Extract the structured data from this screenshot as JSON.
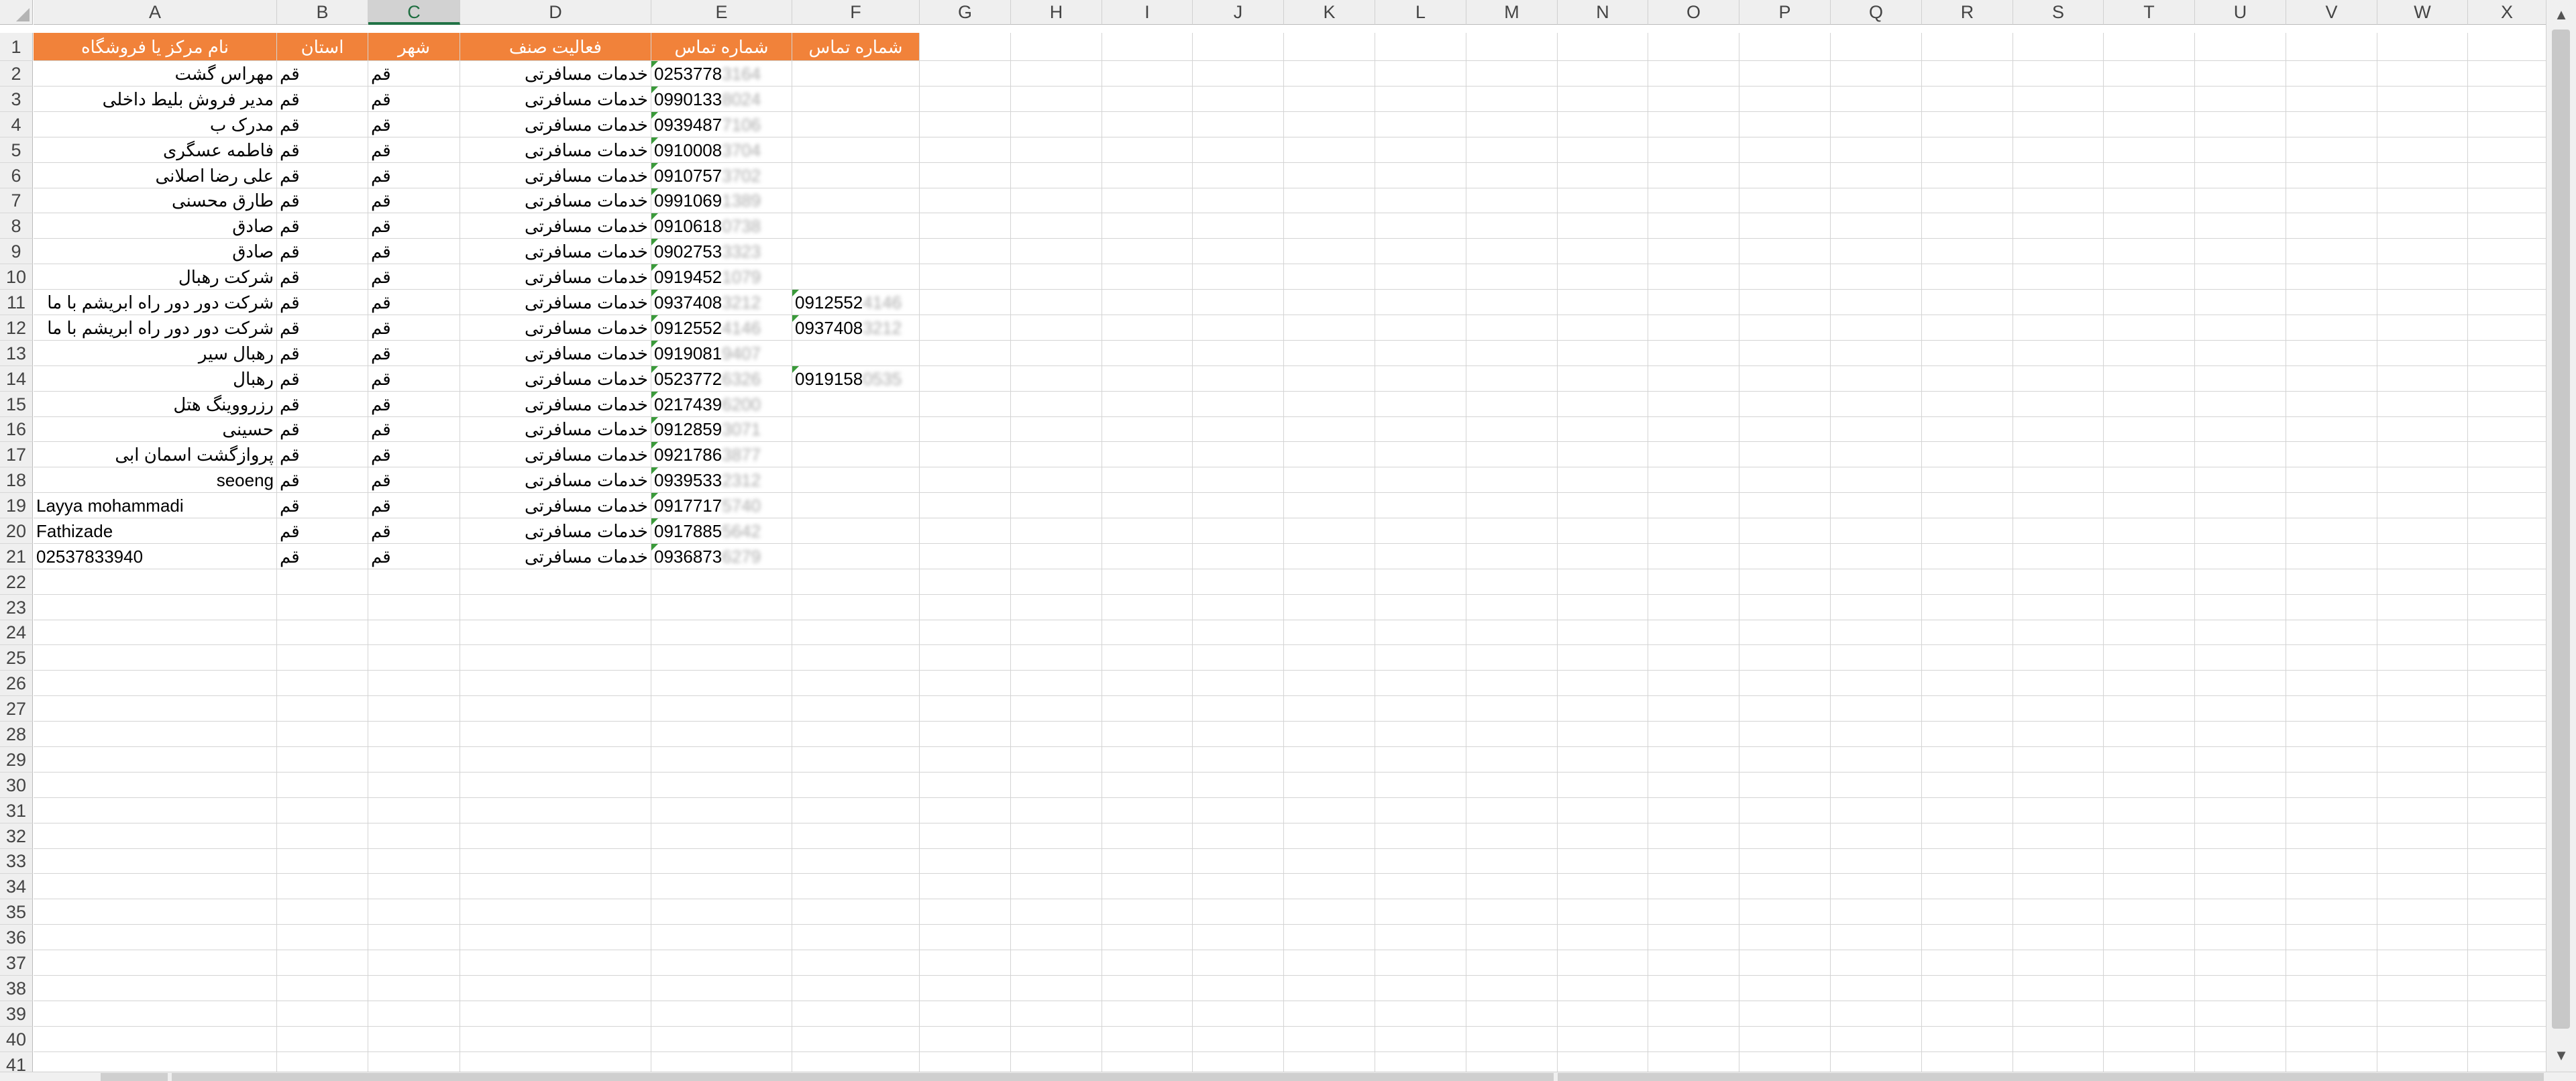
{
  "sheet": {
    "columns": [
      "A",
      "B",
      "C",
      "D",
      "E",
      "F",
      "G",
      "H",
      "I",
      "J",
      "K",
      "L",
      "M",
      "N",
      "O",
      "P",
      "Q",
      "R",
      "S",
      "T",
      "U",
      "V",
      "W",
      "X"
    ],
    "selected_column": "C",
    "row_numbers": [
      "1",
      "2",
      "3",
      "4",
      "5",
      "6",
      "7",
      "8",
      "9",
      "10",
      "11",
      "12",
      "13",
      "14",
      "15",
      "16",
      "17",
      "18",
      "19",
      "20",
      "21",
      "22",
      "23",
      "24",
      "25",
      "26",
      "27",
      "28",
      "29",
      "30",
      "31",
      "32",
      "33",
      "34",
      "35",
      "36",
      "37",
      "38",
      "39",
      "40",
      "41"
    ],
    "header_row": {
      "A": "نام مرکز یا فروشگاه",
      "B": "استان",
      "C": "شهر",
      "D": "فعالیت صنف",
      "E": "شماره تماس",
      "F": "شماره تماس"
    },
    "rows": [
      {
        "a": "مهراس گشت",
        "b": "قم",
        "c": "قم",
        "d": "خدمات مسافرتی",
        "e": "0253778",
        "e_masked": "3164",
        "f": "",
        "f_masked": ""
      },
      {
        "a": "مدیر فروش بلیط داخلی",
        "b": "قم",
        "c": "قم",
        "d": "خدمات مسافرتی",
        "e": "0990133",
        "e_masked": "8024",
        "f": "",
        "f_masked": ""
      },
      {
        "a": "مدرک ب",
        "b": "قم",
        "c": "قم",
        "d": "خدمات مسافرتی",
        "e": "0939487",
        "e_masked": "7106",
        "f": "",
        "f_masked": ""
      },
      {
        "a": "فاطمه عسگری",
        "b": "قم",
        "c": "قم",
        "d": "خدمات مسافرتی",
        "e": "0910008",
        "e_masked": "3704",
        "f": "",
        "f_masked": ""
      },
      {
        "a": "علی رضا اصلانی",
        "b": "قم",
        "c": "قم",
        "d": "خدمات مسافرتی",
        "e": "0910757",
        "e_masked": "3702",
        "f": "",
        "f_masked": ""
      },
      {
        "a": "طارق محسنی",
        "b": "قم",
        "c": "قم",
        "d": "خدمات مسافرتی",
        "e": "0991069",
        "e_masked": "1389",
        "f": "",
        "f_masked": ""
      },
      {
        "a": "صادق",
        "b": "قم",
        "c": "قم",
        "d": "خدمات مسافرتی",
        "e": "0910618",
        "e_masked": "0738",
        "f": "",
        "f_masked": ""
      },
      {
        "a": "صادق",
        "b": "قم",
        "c": "قم",
        "d": "خدمات مسافرتی",
        "e": "0902753",
        "e_masked": "3323",
        "f": "",
        "f_masked": ""
      },
      {
        "a": "شرکت رهبال",
        "b": "قم",
        "c": "قم",
        "d": "خدمات مسافرتی",
        "e": "0919452",
        "e_masked": "1079",
        "f": "",
        "f_masked": ""
      },
      {
        "a": "شرکت دور دور راه ابریشم با ما",
        "b": "قم",
        "c": "قم",
        "d": "خدمات مسافرتی",
        "e": "0937408",
        "e_masked": "3212",
        "f": "0912552",
        "f_masked": "4146"
      },
      {
        "a": "شرکت دور دور راه ابریشم با ما",
        "b": "قم",
        "c": "قم",
        "d": "خدمات مسافرتی",
        "e": "0912552",
        "e_masked": "4146",
        "f": "0937408",
        "f_masked": "3212"
      },
      {
        "a": "رهبال سیر",
        "b": "قم",
        "c": "قم",
        "d": "خدمات مسافرتی",
        "e": "0919081",
        "e_masked": "9407",
        "f": "",
        "f_masked": ""
      },
      {
        "a": "رهبال",
        "b": "قم",
        "c": "قم",
        "d": "خدمات مسافرتی",
        "e": "0523772",
        "e_masked": "6326",
        "f": "0919158",
        "f_masked": "0535"
      },
      {
        "a": "رزرووینگ هتل",
        "b": "قم",
        "c": "قم",
        "d": "خدمات مسافرتی",
        "e": "0217439",
        "e_masked": "6200",
        "f": "",
        "f_masked": ""
      },
      {
        "a": "حسینی",
        "b": "قم",
        "c": "قم",
        "d": "خدمات مسافرتی",
        "e": "0912859",
        "e_masked": "3071",
        "f": "",
        "f_masked": ""
      },
      {
        "a": "پروازگشت اسمان ابی",
        "b": "قم",
        "c": "قم",
        "d": "خدمات مسافرتی",
        "e": "0921786",
        "e_masked": "3877",
        "f": "",
        "f_masked": ""
      },
      {
        "a": "seoeng",
        "b": "قم",
        "c": "قم",
        "d": "خدمات مسافرتی",
        "e": "0939533",
        "e_masked": "2312",
        "f": "",
        "f_masked": ""
      },
      {
        "a": "Layya mohammadi",
        "b": "قم",
        "c": "قم",
        "d": "خدمات مسافرتی",
        "e": "0917717",
        "e_masked": "5740",
        "f": "",
        "f_masked": ""
      },
      {
        "a": "Fathizade",
        "b": "قم",
        "c": "قم",
        "d": "خدمات مسافرتی",
        "e": "0917885",
        "e_masked": "5642",
        "f": "",
        "f_masked": ""
      },
      {
        "a": "02537833940",
        "b": "قم",
        "c": "قم",
        "d": "خدمات مسافرتی",
        "e": "0936873",
        "e_masked": "6279",
        "f": "",
        "f_masked": ""
      }
    ],
    "a_ltr_rows": [
      17,
      18,
      19,
      20
    ],
    "a_flag_rows": [
      20
    ],
    "colors": {
      "header_fill": "#f1823a",
      "header_text": "#ffffff",
      "flag": "#3a9a3a",
      "gridline": "#d4d4d4"
    }
  }
}
